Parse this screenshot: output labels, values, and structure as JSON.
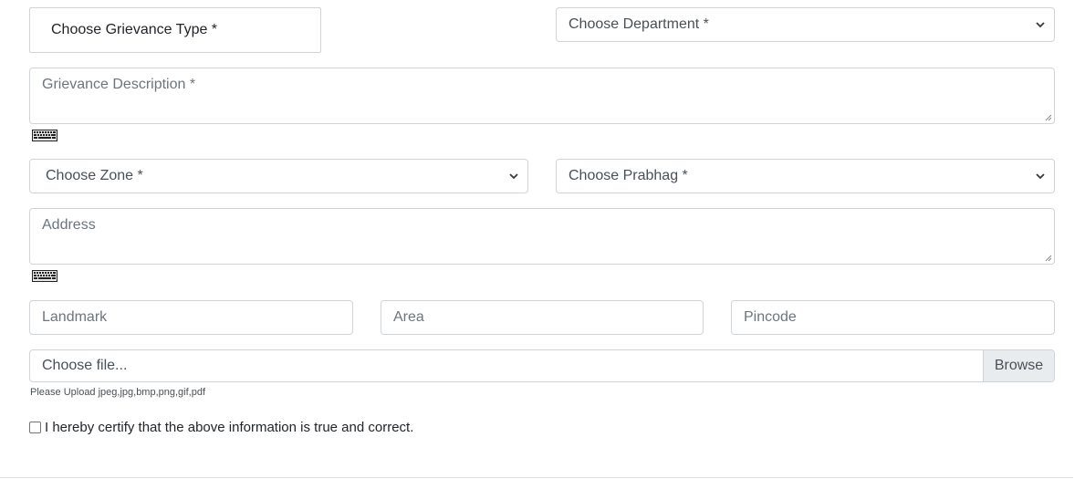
{
  "form": {
    "grievance_type_label": "Choose Grievance Type *",
    "department": {
      "placeholder": "Choose Department *"
    },
    "description": {
      "placeholder": "Grievance Description *"
    },
    "zone": {
      "placeholder": "Choose Zone *"
    },
    "prabhag": {
      "placeholder": "Choose Prabhag *"
    },
    "address": {
      "placeholder": "Address"
    },
    "landmark": {
      "placeholder": "Landmark"
    },
    "area": {
      "placeholder": "Area"
    },
    "pincode": {
      "placeholder": "Pincode"
    },
    "file": {
      "placeholder": "Choose file...",
      "browse_label": "Browse",
      "hint": "Please Upload jpeg,jpg,bmp,png,gif,pdf"
    },
    "certify_label": "I hereby certify that the above information is true and correct."
  },
  "icons": {
    "keyboard": "keyboard-icon",
    "select_arrow": "chevron-down-icon",
    "resize": "resize-handle-icon"
  }
}
